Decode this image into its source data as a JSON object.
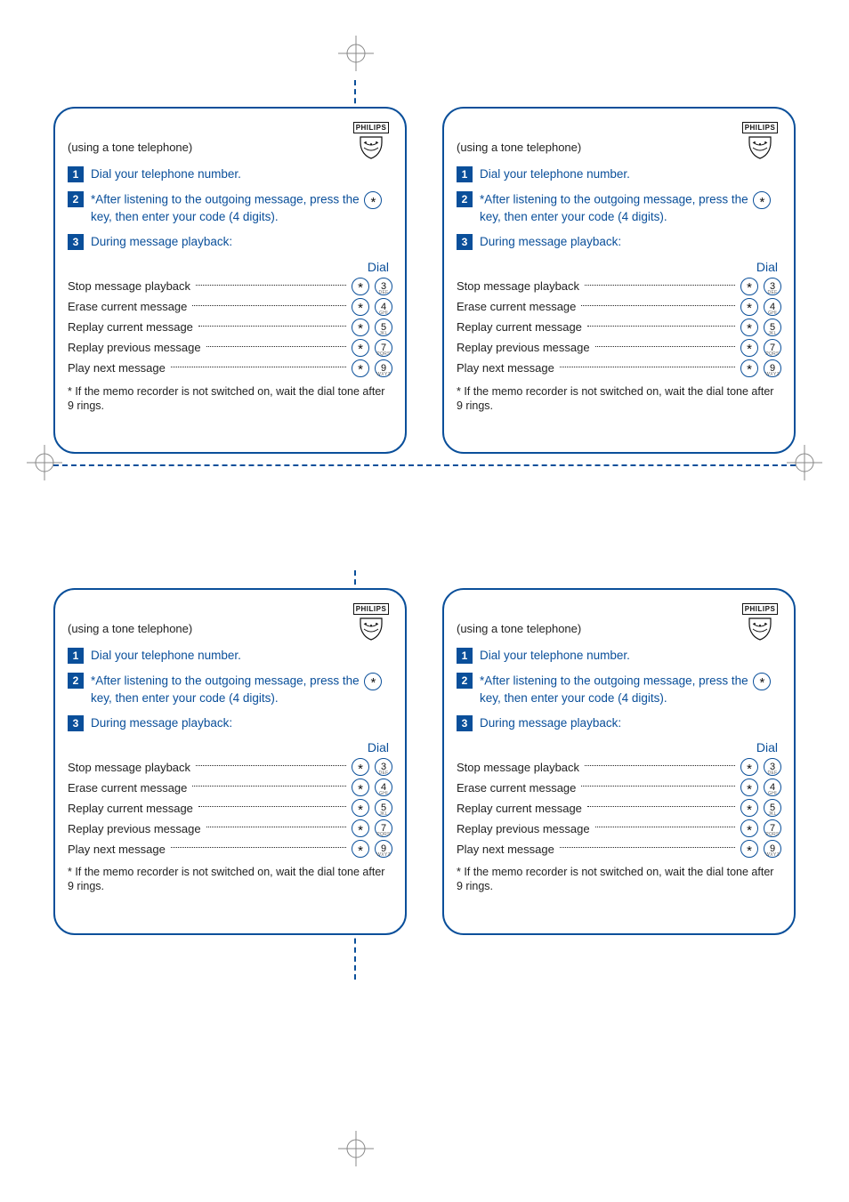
{
  "brand": "PHILIPS",
  "card": {
    "subtitle": "(using a tone telephone)",
    "steps": [
      {
        "num": "1",
        "text": "Dial your telephone number."
      },
      {
        "num": "2",
        "text_a": "*After listening to the outgoing message, press the ",
        "text_b": " key, then enter your code (4 digits)."
      },
      {
        "num": "3",
        "text": "During message playback:"
      }
    ],
    "dial_header": "Dial",
    "rows": [
      {
        "label": "Stop message playback",
        "k1": "star",
        "k2": "n3"
      },
      {
        "label": "Erase current message",
        "k1": "star",
        "k2": "n4"
      },
      {
        "label": "Replay current message",
        "k1": "star",
        "k2": "n5"
      },
      {
        "label": "Replay previous message",
        "k1": "star",
        "k2": "n7"
      },
      {
        "label": "Play next message",
        "k1": "star",
        "k2": "n9"
      }
    ],
    "footnote": "* If the memo recorder is not switched on, wait the dial tone after 9 rings."
  }
}
